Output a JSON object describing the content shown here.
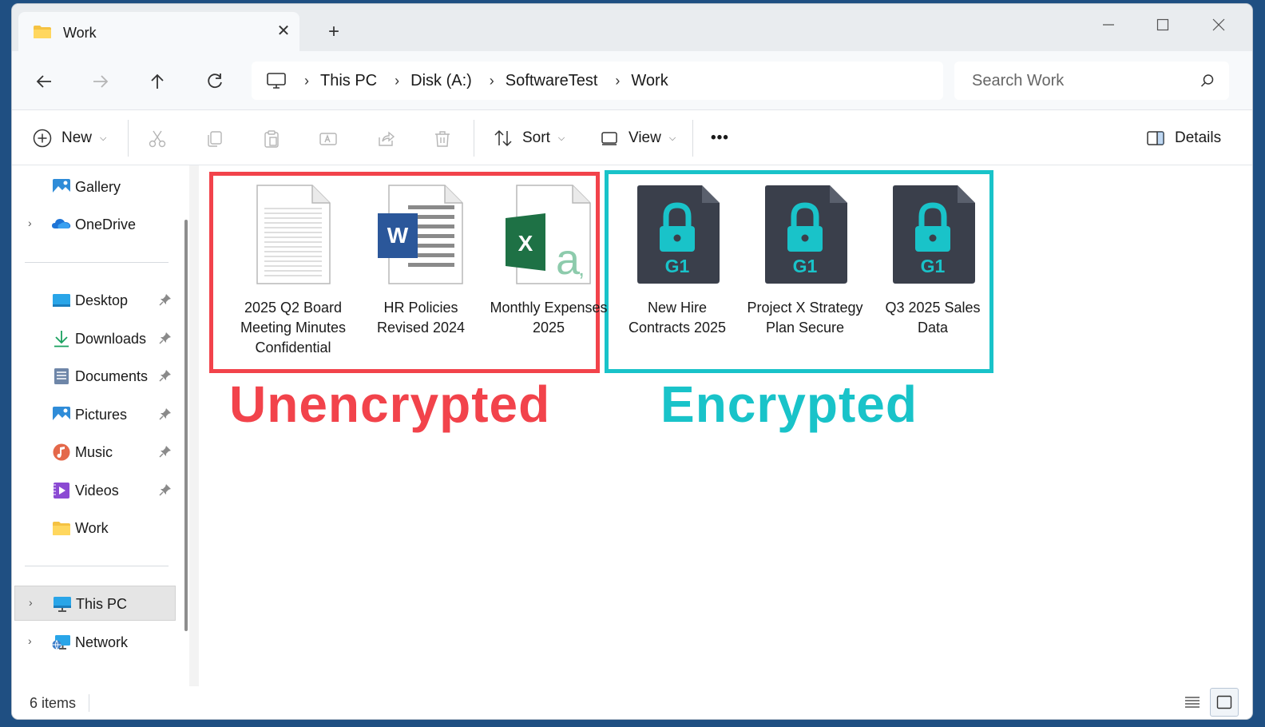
{
  "tab": {
    "title": "Work",
    "close_glyph": "✕",
    "new_glyph": "+"
  },
  "window_controls": {
    "minimize": "—",
    "maximize": "☐",
    "close": "✕"
  },
  "breadcrumb": [
    "This PC",
    "Disk (A:)",
    "SoftwareTest",
    "Work"
  ],
  "search": {
    "placeholder": "Search Work"
  },
  "commands": {
    "new": "New",
    "sort": "Sort",
    "view": "View",
    "more": "•••",
    "details": "Details"
  },
  "sidebar": {
    "top": [
      {
        "label": "Gallery",
        "icon": "gallery-icon",
        "expandable": false
      },
      {
        "label": "OneDrive",
        "icon": "onedrive-icon",
        "expandable": true
      }
    ],
    "quick_access": [
      {
        "label": "Desktop",
        "icon": "desktop-icon",
        "pinned": true
      },
      {
        "label": "Downloads",
        "icon": "downloads-icon",
        "pinned": true
      },
      {
        "label": "Documents",
        "icon": "documents-icon",
        "pinned": true
      },
      {
        "label": "Pictures",
        "icon": "pictures-icon",
        "pinned": true
      },
      {
        "label": "Music",
        "icon": "music-icon",
        "pinned": true
      },
      {
        "label": "Videos",
        "icon": "videos-icon",
        "pinned": true
      },
      {
        "label": "Work",
        "icon": "folder-icon",
        "pinned": false
      }
    ],
    "bottom": [
      {
        "label": "This PC",
        "icon": "this-pc-icon",
        "selected": true
      },
      {
        "label": "Network",
        "icon": "network-icon",
        "selected": false
      }
    ]
  },
  "groups": {
    "unencrypted": {
      "label": "Unencrypted",
      "color": "#f2434b"
    },
    "encrypted": {
      "label": "Encrypted",
      "color": "#19c3c9"
    }
  },
  "files": [
    {
      "label": "2025 Q2 Board Meeting Minutes Confidential",
      "icon": "text-document-icon",
      "group": "unencrypted"
    },
    {
      "label": "HR Policies Revised 2024",
      "icon": "word-document-icon",
      "group": "unencrypted"
    },
    {
      "label": "Monthly Expenses 2025",
      "icon": "excel-spreadsheet-icon",
      "group": "unencrypted"
    },
    {
      "label": "New Hire Contracts 2025",
      "icon": "encrypted-file-icon",
      "group": "encrypted",
      "badge": "G1"
    },
    {
      "label": "Project X Strategy Plan Secure",
      "icon": "encrypted-file-icon",
      "group": "encrypted",
      "badge": "G1"
    },
    {
      "label": "Q3 2025 Sales Data",
      "icon": "encrypted-file-icon",
      "group": "encrypted",
      "badge": "G1"
    }
  ],
  "status": {
    "item_count": "6 items"
  },
  "colors": {
    "word_blue": "#2b579a",
    "excel_green": "#1e7145",
    "lock_cyan": "#19c3c9",
    "encrypted_bg": "#3a3f4b"
  }
}
